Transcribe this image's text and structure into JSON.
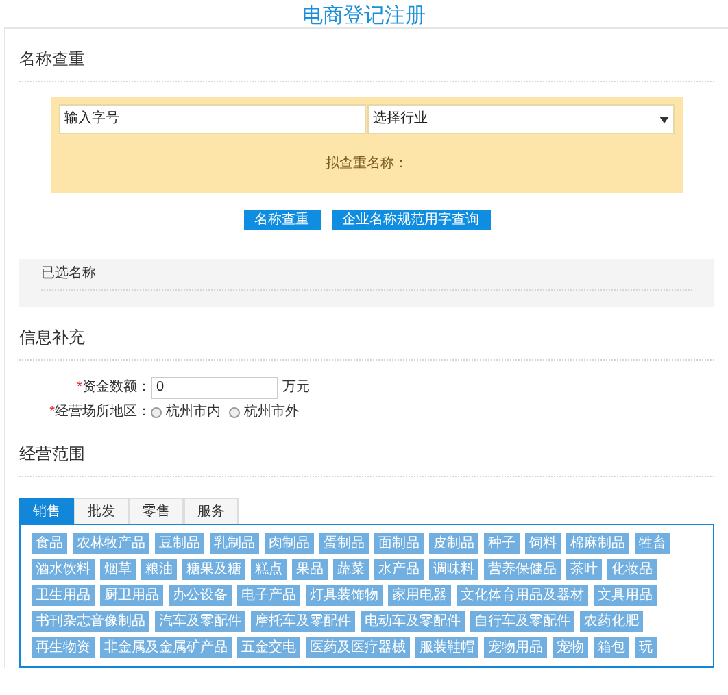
{
  "title": "电商登记注册",
  "name_check": {
    "heading": "名称查重",
    "name_input": {
      "value": "输入字号"
    },
    "industry_select": {
      "value": "选择行业"
    },
    "proposed_label": "拟查重名称：",
    "buttons": [
      "名称查重",
      "企业名称规范用字查询"
    ]
  },
  "selected_names": {
    "heading": "已选名称"
  },
  "info": {
    "heading": "信息补充",
    "capital": {
      "required_mark": "*",
      "label": "资金数额：",
      "value": "0",
      "unit": "万元"
    },
    "region": {
      "required_mark": "*",
      "label": "经营场所地区：",
      "options": [
        {
          "label": "杭州市内",
          "selected": false
        },
        {
          "label": "杭州市外",
          "selected": false
        }
      ]
    }
  },
  "scope": {
    "heading": "经营范围",
    "tabs": [
      {
        "label": "销售",
        "selected": true
      },
      {
        "label": "批发",
        "selected": false
      },
      {
        "label": "零售",
        "selected": false
      },
      {
        "label": "服务",
        "selected": false
      }
    ],
    "tags": [
      "食品",
      "农林牧产品",
      "豆制品",
      "乳制品",
      "肉制品",
      "蛋制品",
      "面制品",
      "皮制品",
      "种子",
      "饲料",
      "棉麻制品",
      "牲畜",
      "酒水饮料",
      "烟草",
      "粮油",
      "糖果及糖",
      "糕点",
      "果品",
      "蔬菜",
      "水产品",
      "调味料",
      "营养保健品",
      "茶叶",
      "化妆品",
      "卫生用品",
      "厨卫用品",
      "办公设备",
      "电子产品",
      "灯具装饰物",
      "家用电器",
      "文化体育用品及器材",
      "文具用品",
      "书刊杂志音像制品",
      "汽车及零配件",
      "摩托车及零配件",
      "电动车及零配件",
      "自行车及零配件",
      "农药化肥",
      "再生物资",
      "非金属及金属矿产品",
      "五金交电",
      "医药及医疗器械",
      "服装鞋帽",
      "宠物用品",
      "宠物",
      "箱包",
      "玩"
    ]
  }
}
